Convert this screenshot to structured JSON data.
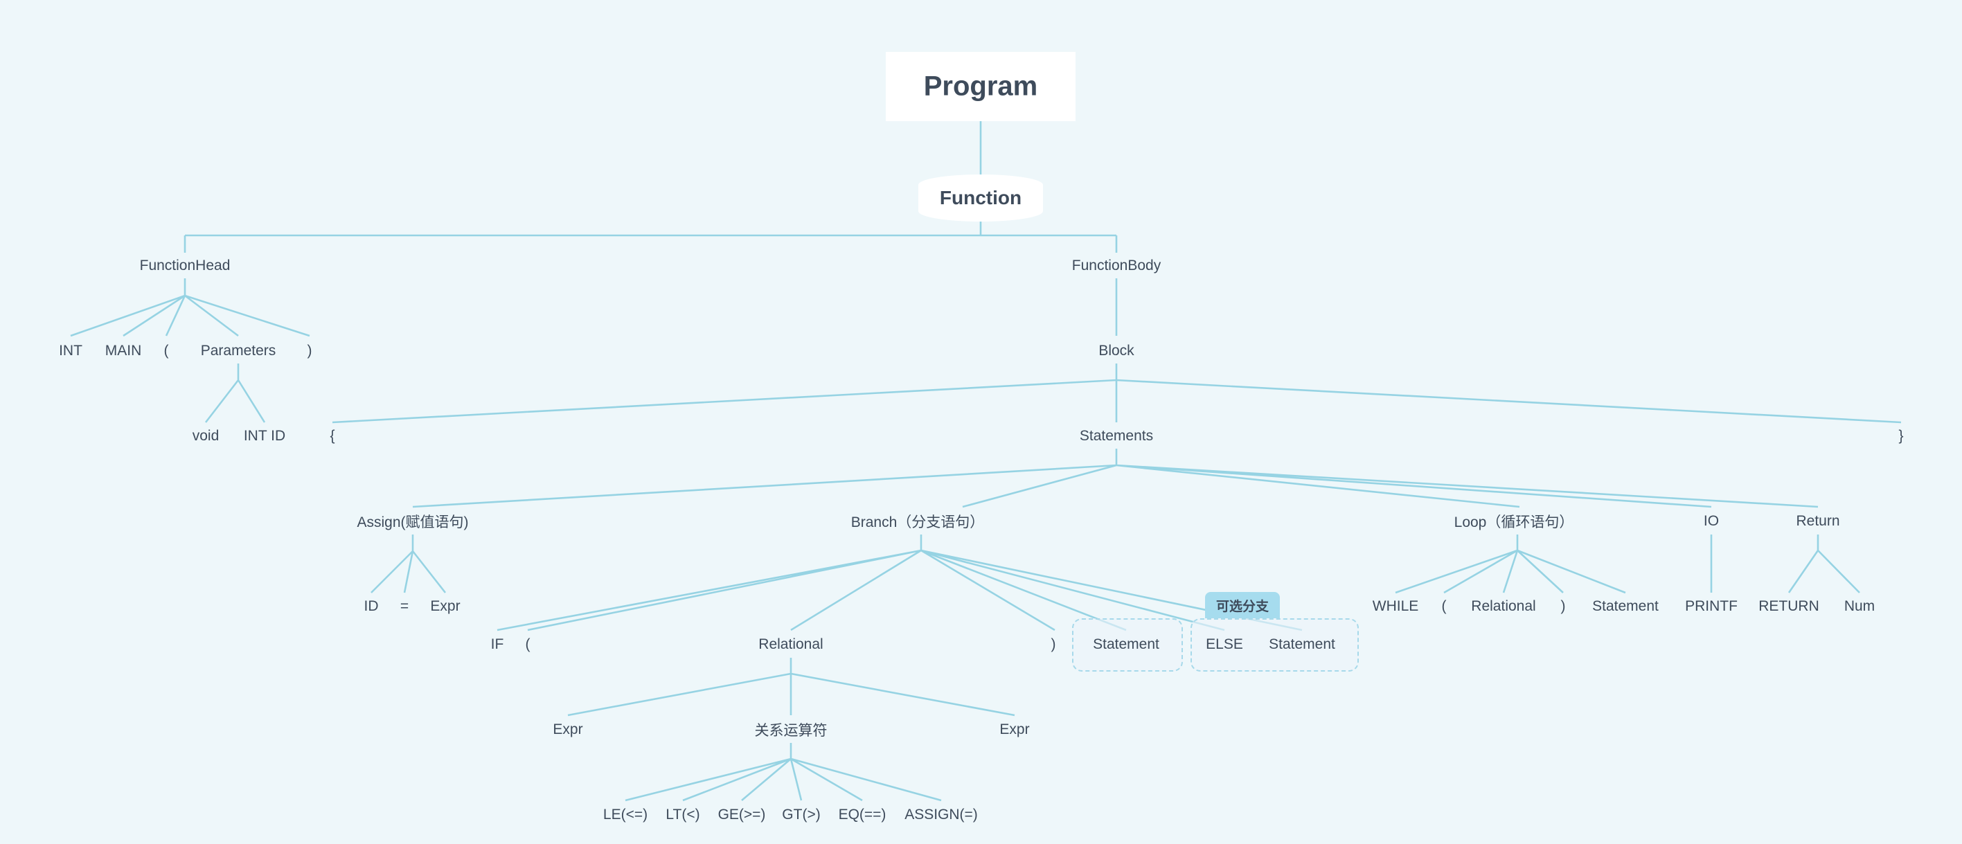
{
  "title": "Program",
  "function": "Function",
  "function_head": {
    "label": "FunctionHead",
    "int": "INT",
    "main": "MAIN",
    "lparen": "(",
    "parameters": "Parameters",
    "rparen": ")",
    "void": "void",
    "int_id": "INT ID"
  },
  "function_body": {
    "label": "FunctionBody",
    "block": "Block",
    "lbrace": "{",
    "statements": "Statements",
    "rbrace": "}"
  },
  "assign": {
    "label": "Assign(赋值语句)",
    "id": "ID",
    "eq": "=",
    "expr": "Expr"
  },
  "branch": {
    "label": "Branch（分支语句）",
    "if": "IF",
    "lparen": "(",
    "relational": "Relational",
    "rparen": ")",
    "statement": "Statement",
    "else": "ELSE",
    "else_statement": "Statement",
    "optional_tag": "可选分支"
  },
  "relational": {
    "expr_left": "Expr",
    "operator": "关系运算符",
    "expr_right": "Expr",
    "ops": [
      "LE(<=)",
      "LT(<)",
      "GE(>=)",
      "GT(>)",
      "EQ(==)",
      "ASSIGN(=)"
    ]
  },
  "loop": {
    "label": "Loop（循环语句）",
    "while": "WHILE",
    "lparen": "(",
    "relational": "Relational",
    "rparen": ")",
    "statement": "Statement"
  },
  "io": {
    "label": "IO",
    "printf": "PRINTF"
  },
  "return": {
    "label": "Return",
    "return_kw": "RETURN",
    "num": "Num"
  },
  "colors": {
    "background": "#eef7fa",
    "edge": "#96d3e3",
    "text": "#3e4b5b",
    "tag": "#a6dcee"
  }
}
